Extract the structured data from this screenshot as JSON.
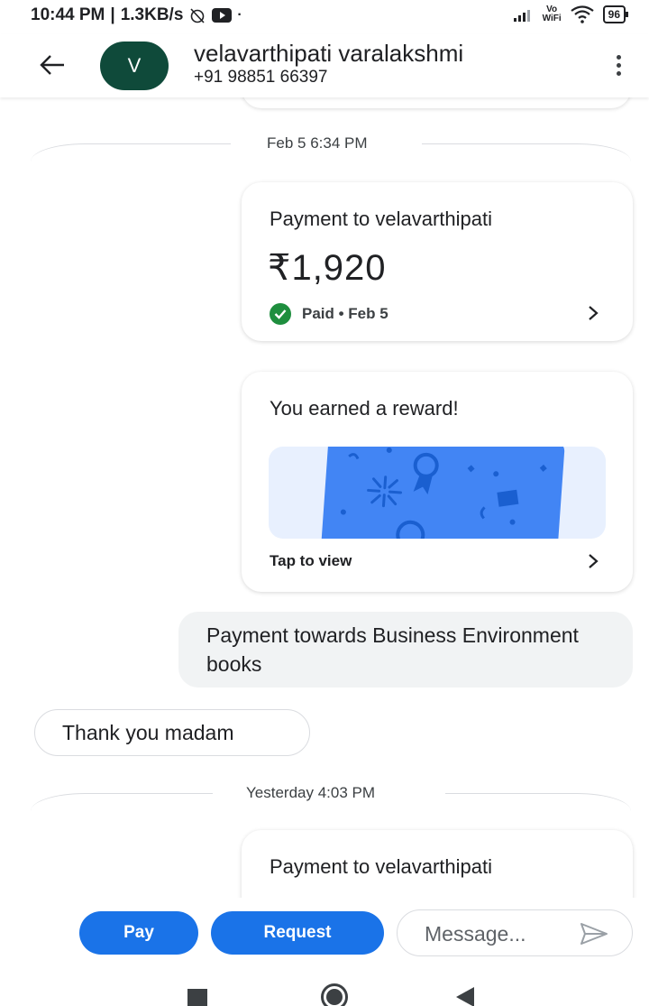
{
  "status_bar": {
    "time": "10:44 PM",
    "network_speed": "1.3KB/s",
    "volte_top": "Vo",
    "volte_bottom": "WiFi",
    "battery": "96"
  },
  "header": {
    "avatar_letter": "V",
    "contact_name": "velavarthipati varalakshmi",
    "phone": "+91 98851 66397"
  },
  "messages": {
    "date_1": "Feb 5 6:34 PM",
    "payment_1": {
      "title": "Payment to velavarthipati",
      "amount": "₹1,920",
      "status": "Paid • Feb 5"
    },
    "reward": {
      "title": "You earned a reward!",
      "action": "Tap to view"
    },
    "outgoing_text": "Payment towards Business Environment books",
    "incoming_text": "Thank you madam",
    "date_2": "Yesterday 4:03 PM",
    "payment_2": {
      "title": "Payment to velavarthipati"
    }
  },
  "actions": {
    "pay_label": "Pay",
    "request_label": "Request",
    "message_placeholder": "Message..."
  },
  "colors": {
    "primary": "#1a73e8",
    "avatar_bg": "#0f4a3a",
    "paid_green": "#1e8e3e",
    "reward_card": "#4285f4"
  },
  "icons": {
    "back": "arrow-left-icon",
    "more": "more-vert-icon",
    "paid": "check-circle-icon",
    "chevron": "chevron-right-icon",
    "send": "send-icon"
  }
}
